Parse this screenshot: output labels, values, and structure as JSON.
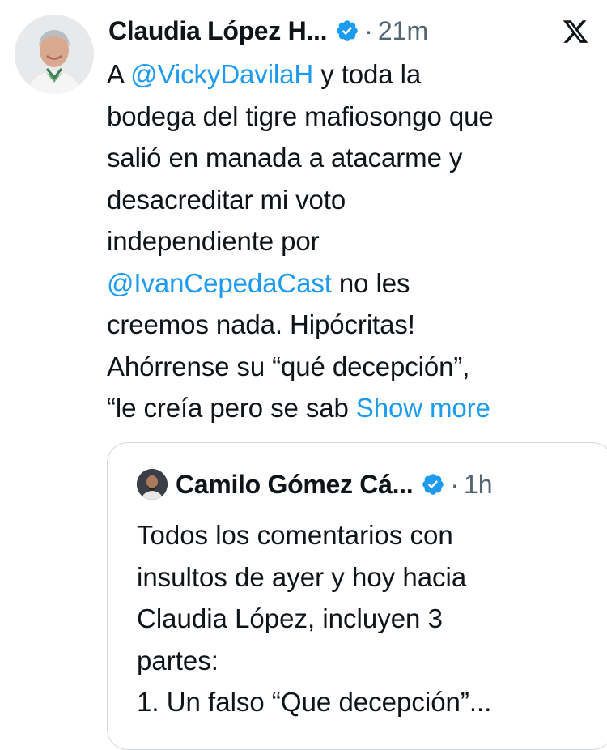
{
  "tweet": {
    "author_name": "Claudia López H...",
    "separator": "·",
    "time": "21m",
    "body_segments": [
      {
        "type": "text",
        "value": "A "
      },
      {
        "type": "mention",
        "value": "@VickyDavilaH"
      },
      {
        "type": "text",
        "value": " y toda la\nbodega del tigre mafiosongo que\nsalió en manada a atacarme y\ndesacreditar mi voto\nindependiente por\n"
      },
      {
        "type": "mention",
        "value": "@IvanCepedaCast"
      },
      {
        "type": "text",
        "value": " no les\ncreemos nada. Hipócritas!\nAhórrense su “qué decepción”,\n“le creía pero se sab "
      },
      {
        "type": "show_more",
        "value": "Show more"
      }
    ]
  },
  "quoted_tweet": {
    "author_name": "Camilo Gómez Cá...",
    "separator": "·",
    "time": "1h",
    "text": "Todos los comentarios con\ninsultos de ayer y hoy hacia\nClaudia López, incluyen 3\npartes:\n1. Un falso “Que decepción”..."
  },
  "icons": {
    "verified": "verified-badge-icon",
    "platform": "x-logo-icon"
  },
  "colors": {
    "link": "#1d9bf0",
    "text": "#0f1419",
    "muted": "#536471",
    "border": "#cfd9de"
  }
}
